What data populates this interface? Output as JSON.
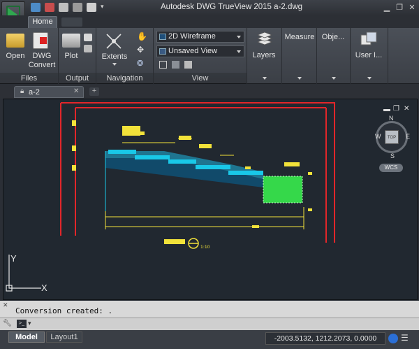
{
  "window": {
    "title": "Autodesk DWG TrueView 2015    a-2.dwg",
    "minimize": "▁",
    "restore": "❐",
    "close": "✕"
  },
  "ribbon": {
    "tabs": [
      "Home"
    ],
    "panels": {
      "files": {
        "label": "Files",
        "buttons": [
          "Open",
          "DWG Convert"
        ]
      },
      "output": {
        "label": "Output",
        "buttons": [
          "Plot"
        ]
      },
      "navigation": {
        "label": "Navigation",
        "buttons": [
          "Extents"
        ]
      },
      "view": {
        "label": "View",
        "visual_style": "2D Wireframe",
        "named_view": "Unsaved View"
      },
      "layers": {
        "label": "Layers"
      },
      "measure": {
        "label": "Measure"
      },
      "objects": {
        "label": "Obje..."
      },
      "user_interface": {
        "label": "User I..."
      }
    }
  },
  "document_tabs": [
    {
      "label": "a-2"
    }
  ],
  "viewcube": {
    "top_label": "TOP",
    "north": "N",
    "south": "S",
    "east": "E",
    "west": "W",
    "wcs": "WCS"
  },
  "ucs": {
    "x": "X",
    "y": "Y"
  },
  "drawing": {
    "title_text": "",
    "scale": "1:10"
  },
  "command": {
    "history": "Conversion created: .",
    "prompt_icon": ">_"
  },
  "layout_tabs": [
    "Model",
    "Layout1"
  ],
  "status": {
    "coordinates": "-2003.5132, 1212.2073, 0.0000"
  },
  "colors": {
    "accent_green": "#2fa84f",
    "frame_red": "#e3262a",
    "drawing_yellow": "#f2e23a",
    "drawing_cyan": "#19c8e8",
    "drawing_green": "#35d84a"
  }
}
